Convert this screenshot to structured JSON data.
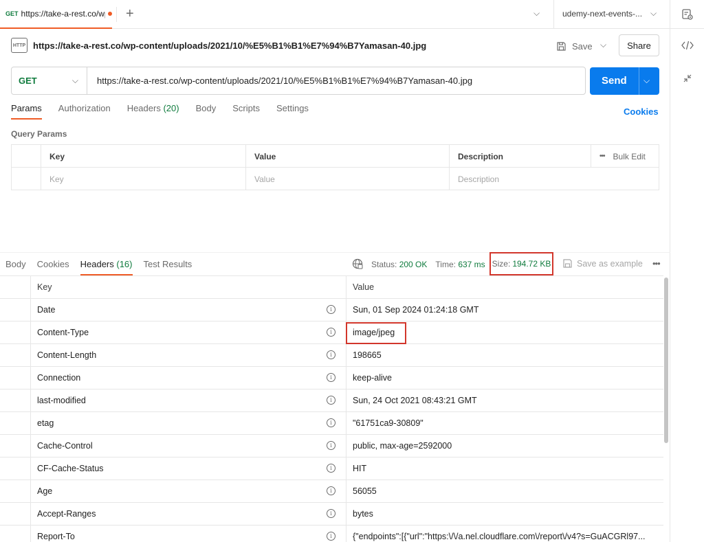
{
  "tab": {
    "method": "GET",
    "title": "https://take-a-rest.co/wp-content/uploads/2021/10/%E5%B1%B1%E7%94%B7Yamasan-40.jpg",
    "unsaved_color": "#ef5b25"
  },
  "environment": {
    "name": "udemy-next-events-..."
  },
  "request": {
    "badge": "HTTP",
    "title": "https://take-a-rest.co/wp-content/uploads/2021/10/%E5%B1%B1%E7%94%B7Yamasan-40.jpg",
    "save_label": "Save",
    "share_label": "Share",
    "method": "GET",
    "url": "https://take-a-rest.co/wp-content/uploads/2021/10/%E5%B1%B1%E7%94%B7Yamasan-40.jpg",
    "send_label": "Send"
  },
  "request_tabs": {
    "params": "Params",
    "authorization": "Authorization",
    "headers": "Headers",
    "headers_count": "(20)",
    "body": "Body",
    "scripts": "Scripts",
    "settings": "Settings",
    "cookies": "Cookies"
  },
  "query_params": {
    "title": "Query Params",
    "columns": {
      "key": "Key",
      "value": "Value",
      "description": "Description",
      "bulk_edit": "Bulk Edit"
    },
    "placeholders": {
      "key": "Key",
      "value": "Value",
      "description": "Description"
    }
  },
  "response": {
    "tabs": {
      "body": "Body",
      "cookies": "Cookies",
      "headers": "Headers",
      "headers_count": "(16)",
      "test_results": "Test Results"
    },
    "status_label": "Status:",
    "status_value": "200 OK",
    "time_label": "Time:",
    "time_value": "637 ms",
    "size_label": "Size:",
    "size_value": "194.72 KB",
    "save_example": "Save as example",
    "header_columns": {
      "key": "Key",
      "value": "Value"
    },
    "headers": [
      {
        "key": "Date",
        "value": "Sun, 01 Sep 2024 01:24:18 GMT"
      },
      {
        "key": "Content-Type",
        "value": "image/jpeg"
      },
      {
        "key": "Content-Length",
        "value": "198665"
      },
      {
        "key": "Connection",
        "value": "keep-alive"
      },
      {
        "key": "last-modified",
        "value": "Sun, 24 Oct 2021 08:43:21 GMT"
      },
      {
        "key": "etag",
        "value": "\"61751ca9-30809\""
      },
      {
        "key": "Cache-Control",
        "value": "public, max-age=2592000"
      },
      {
        "key": "CF-Cache-Status",
        "value": "HIT"
      },
      {
        "key": "Age",
        "value": "56055"
      },
      {
        "key": "Accept-Ranges",
        "value": "bytes"
      },
      {
        "key": "Report-To",
        "value": "{\"endpoints\":[{\"url\":\"https:\\/\\/a.nel.cloudflare.com\\/report\\/v4?s=GuACGRl97..."
      }
    ]
  },
  "colors": {
    "accent": "#ef5b25",
    "send": "#097bed",
    "method": "#0f7b3d",
    "highlight": "#d2362b"
  }
}
